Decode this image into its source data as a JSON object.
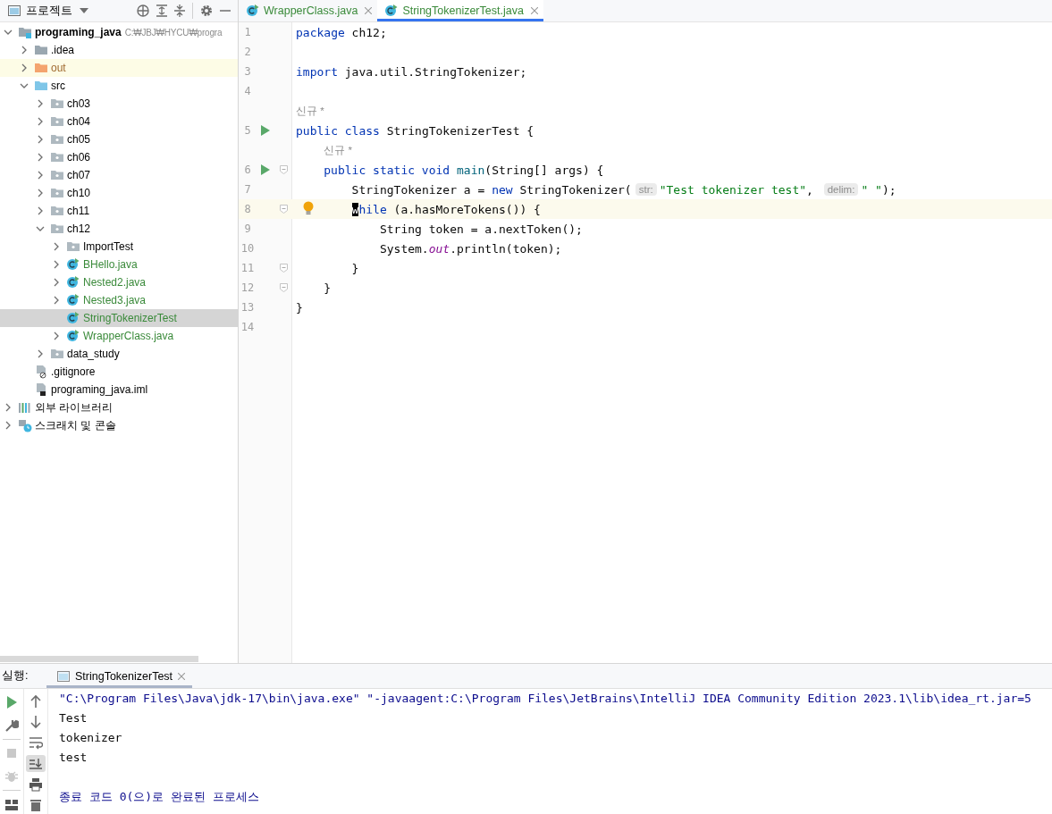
{
  "project_panel": {
    "title": "프로젝트",
    "tree": [
      {
        "label": "programing_java",
        "kind": "module",
        "path": "C:₩JBJ₩HYCU₩progra",
        "expanded": true,
        "selected": false,
        "highlighted": false,
        "children": [
          {
            "label": ".idea",
            "kind": "folder",
            "expanded": false,
            "selected": false,
            "highlighted": false
          },
          {
            "label": "out",
            "kind": "excluded",
            "expanded": false,
            "selected": false,
            "highlighted": true
          },
          {
            "label": "src",
            "kind": "source",
            "expanded": true,
            "selected": false,
            "highlighted": false,
            "children": [
              {
                "label": "ch03",
                "kind": "package",
                "expanded": false,
                "selected": false,
                "highlighted": false
              },
              {
                "label": "ch04",
                "kind": "package",
                "expanded": false,
                "selected": false,
                "highlighted": false
              },
              {
                "label": "ch05",
                "kind": "package",
                "expanded": false,
                "selected": false,
                "highlighted": false
              },
              {
                "label": "ch06",
                "kind": "package",
                "expanded": false,
                "selected": false,
                "highlighted": false
              },
              {
                "label": "ch07",
                "kind": "package",
                "expanded": false,
                "selected": false,
                "highlighted": false
              },
              {
                "label": "ch10",
                "kind": "package",
                "expanded": false,
                "selected": false,
                "highlighted": false
              },
              {
                "label": "ch11",
                "kind": "package",
                "expanded": false,
                "selected": false,
                "highlighted": false
              },
              {
                "label": "ch12",
                "kind": "package",
                "expanded": true,
                "selected": false,
                "highlighted": false,
                "children": [
                  {
                    "label": "ImportTest",
                    "kind": "package",
                    "expanded": false,
                    "selected": false,
                    "highlighted": false
                  },
                  {
                    "label": "BHello.java",
                    "kind": "java",
                    "expanded": false,
                    "selected": false,
                    "highlighted": false
                  },
                  {
                    "label": "Nested2.java",
                    "kind": "java",
                    "expanded": false,
                    "selected": false,
                    "highlighted": false
                  },
                  {
                    "label": "Nested3.java",
                    "kind": "java",
                    "expanded": false,
                    "selected": false,
                    "highlighted": false
                  },
                  {
                    "label": "StringTokenizerTest",
                    "kind": "java",
                    "selected": true,
                    "highlighted": false
                  },
                  {
                    "label": "WrapperClass.java",
                    "kind": "java",
                    "expanded": false,
                    "selected": false,
                    "highlighted": false
                  }
                ]
              },
              {
                "label": "data_study",
                "kind": "package",
                "expanded": false,
                "selected": false,
                "highlighted": false
              }
            ]
          },
          {
            "label": ".gitignore",
            "kind": "ignore",
            "selected": false,
            "highlighted": false
          },
          {
            "label": "programing_java.iml",
            "kind": "iml",
            "selected": false,
            "highlighted": false
          }
        ]
      },
      {
        "label": "외부 라이브러리",
        "kind": "libraries",
        "expanded": false,
        "selected": false,
        "highlighted": false
      },
      {
        "label": "스크래치 및 콘솔",
        "kind": "scratches",
        "expanded": false,
        "selected": false,
        "highlighted": false
      }
    ]
  },
  "editor": {
    "tabs": [
      {
        "label": "WrapperClass.java",
        "selected": false
      },
      {
        "label": "StringTokenizerTest.java",
        "selected": true
      }
    ],
    "lines": [
      {
        "kind": "code",
        "number": "1",
        "tokens": [
          {
            "kind": "kw",
            "text": "package"
          },
          {
            "kind": "plain",
            "text": " ch12;"
          }
        ]
      },
      {
        "kind": "code",
        "number": "2"
      },
      {
        "kind": "code",
        "number": "3",
        "tokens": [
          {
            "kind": "kw",
            "text": "import"
          },
          {
            "kind": "plain",
            "text": " java.util.StringTokenizer;"
          }
        ]
      },
      {
        "kind": "code",
        "number": "4"
      },
      {
        "kind": "inlay",
        "text": "신규 *"
      },
      {
        "kind": "code",
        "number": "5",
        "run": true,
        "tokens": [
          {
            "kind": "kw",
            "text": "public class"
          },
          {
            "kind": "plain",
            "text": " StringTokenizerTest {"
          }
        ],
        "children": [
          {
            "kind": "inlay",
            "text": "신규 *"
          },
          {
            "kind": "code",
            "number": "6",
            "run": true,
            "fold": true,
            "tokens": [
              {
                "kind": "kw",
                "text": "public static void"
              },
              {
                "kind": "method",
                "text": " main"
              },
              {
                "kind": "plain",
                "text": "(String[] args) {"
              }
            ],
            "children": [
              {
                "kind": "code",
                "number": "7",
                "tokens": [
                  {
                    "kind": "plain",
                    "text": "StringTokenizer a = "
                  },
                  {
                    "kind": "kw",
                    "text": "new"
                  },
                  {
                    "kind": "plain",
                    "text": " StringTokenizer("
                  },
                  {
                    "kind": "hint",
                    "text": "str:"
                  },
                  {
                    "kind": "str",
                    "text": "\"Test tokenizer test\""
                  },
                  {
                    "kind": "plain",
                    "text": ", "
                  },
                  {
                    "kind": "hint",
                    "text": "delim:"
                  },
                  {
                    "kind": "str",
                    "text": "\" \""
                  },
                  {
                    "kind": "plain",
                    "text": ");"
                  }
                ]
              },
              {
                "kind": "code",
                "number": "8",
                "current": true,
                "fold": true,
                "bulb": true,
                "tokens": [
                  {
                    "kind": "caret",
                    "text": "w"
                  },
                  {
                    "kind": "kw",
                    "text": "hile"
                  },
                  {
                    "kind": "plain",
                    "text": " (a.hasMoreTokens()) {"
                  }
                ],
                "children": [
                  {
                    "kind": "code",
                    "number": "9",
                    "tokens": [
                      {
                        "kind": "plain",
                        "text": "String token = a.nextToken();"
                      }
                    ]
                  },
                  {
                    "kind": "code",
                    "number": "10",
                    "tokens": [
                      {
                        "kind": "plain",
                        "text": "System."
                      },
                      {
                        "kind": "field",
                        "text": "out"
                      },
                      {
                        "kind": "plain",
                        "text": ".println(token);"
                      }
                    ]
                  }
                ]
              },
              {
                "kind": "code",
                "number": "11",
                "fold": true,
                "tokens": [
                  {
                    "kind": "plain",
                    "text": "}"
                  }
                ]
              }
            ]
          },
          {
            "kind": "code",
            "number": "12",
            "fold": true,
            "tokens": [
              {
                "kind": "plain",
                "text": "}"
              }
            ]
          }
        ]
      },
      {
        "kind": "code",
        "number": "13",
        "tokens": [
          {
            "kind": "plain",
            "text": "}"
          }
        ]
      },
      {
        "kind": "code",
        "number": "14"
      }
    ]
  },
  "run_panel": {
    "label": "실행:",
    "tab": "StringTokenizerTest",
    "tools_left": [
      {
        "kind": "run",
        "on": false
      },
      {
        "kind": "wrench",
        "on": false
      },
      {
        "kind": "stop",
        "on": false
      },
      {
        "kind": "debug",
        "on": false
      },
      {
        "kind": "layout",
        "on": false
      }
    ],
    "tools_right": [
      {
        "kind": "up",
        "on": false
      },
      {
        "kind": "down",
        "on": false
      },
      {
        "kind": "wrap",
        "on": false
      },
      {
        "kind": "scroll-end",
        "on": true
      },
      {
        "kind": "print",
        "on": false
      },
      {
        "kind": "trash",
        "on": false
      }
    ],
    "console": [
      {
        "kind": "system",
        "text": "\"C:\\Program Files\\Java\\jdk-17\\bin\\java.exe\" \"-javaagent:C:\\Program Files\\JetBrains\\IntelliJ IDEA Community Edition 2023.1\\lib\\idea_rt.jar=5"
      },
      {
        "kind": "output",
        "text": "Test"
      },
      {
        "kind": "output",
        "text": "tokenizer"
      },
      {
        "kind": "output",
        "text": "test"
      },
      {
        "kind": "blank"
      },
      {
        "kind": "system",
        "text": "종료 코드 0(으)로 완료된 프로세스"
      }
    ]
  }
}
